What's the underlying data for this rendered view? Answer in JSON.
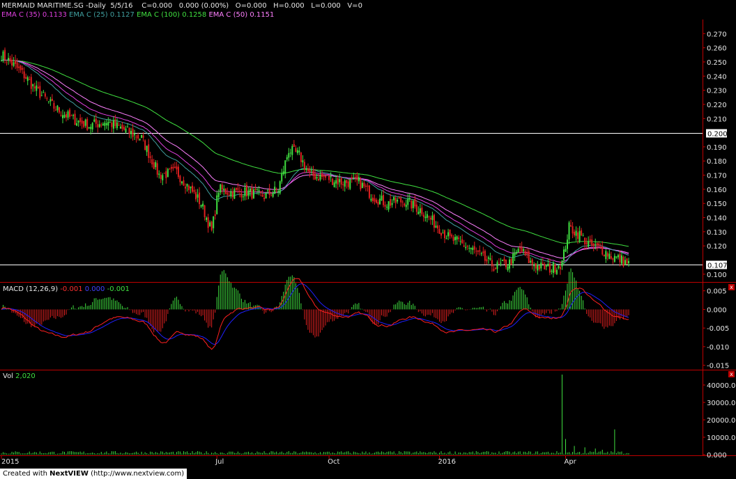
{
  "header": {
    "symbol": "MERMAID MARITIME.SG",
    "period": "-Daily",
    "date": "5/5/16",
    "close": "C=0.000",
    "change": "0.000 (0.00%)",
    "open": "O=0.000",
    "high": "H=0.000",
    "low": "L=0.000",
    "volume": "V=0"
  },
  "ema_legend": [
    {
      "label": "EMA C (35)",
      "value": "0.1133",
      "color": "#e040e0"
    },
    {
      "label": "EMA C (25)",
      "value": "0.1127",
      "color": "#40a0a0"
    },
    {
      "label": "EMA C (100)",
      "value": "0.1258",
      "color": "#40e040"
    },
    {
      "label": "EMA C (50)",
      "value": "0.1151",
      "color": "#ff80ff"
    }
  ],
  "macd_legend": {
    "label": "MACD (12,26,9)",
    "macd": "-0.001",
    "signal": "0.000",
    "hist": "-0.001"
  },
  "vol_legend": {
    "label": "Vol",
    "value": "2,020"
  },
  "footer": {
    "prefix": "Created with ",
    "brand_a": "Next",
    "brand_b": "VIEW",
    "url": "(http://www.nextview.com)"
  },
  "close_buttons": [
    "x",
    "x"
  ],
  "chart_data": [
    {
      "type": "candlestick",
      "title": "MERMAID MARITIME.SG -Daily",
      "ylim": [
        0.095,
        0.28
      ],
      "yticks": [
        "0.270",
        "0.260",
        "0.250",
        "0.240",
        "0.230",
        "0.220",
        "0.210",
        "0.200",
        "0.190",
        "0.180",
        "0.170",
        "0.160",
        "0.150",
        "0.140",
        "0.130",
        "0.120",
        "0.110",
        "0.100"
      ],
      "horizontal_lines": [
        {
          "value": 0.2,
          "label": "0.200"
        },
        {
          "value": 0.107,
          "label": "0.107"
        }
      ],
      "x_labels": [
        "2015",
        "Jul",
        "Oct",
        "2016",
        "Apr"
      ],
      "close_anchors": [
        [
          0,
          0.255
        ],
        [
          5,
          0.25
        ],
        [
          12,
          0.242
        ],
        [
          20,
          0.23
        ],
        [
          30,
          0.218
        ],
        [
          40,
          0.21
        ],
        [
          50,
          0.205
        ],
        [
          60,
          0.208
        ],
        [
          70,
          0.202
        ],
        [
          80,
          0.196
        ],
        [
          90,
          0.17
        ],
        [
          100,
          0.172
        ],
        [
          108,
          0.16
        ],
        [
          114,
          0.15
        ],
        [
          120,
          0.13
        ],
        [
          124,
          0.16
        ],
        [
          130,
          0.158
        ],
        [
          140,
          0.158
        ],
        [
          150,
          0.155
        ],
        [
          158,
          0.16
        ],
        [
          164,
          0.188
        ],
        [
          170,
          0.184
        ],
        [
          176,
          0.17
        ],
        [
          186,
          0.168
        ],
        [
          194,
          0.165
        ],
        [
          204,
          0.165
        ],
        [
          212,
          0.155
        ],
        [
          220,
          0.15
        ],
        [
          230,
          0.152
        ],
        [
          240,
          0.145
        ],
        [
          248,
          0.135
        ],
        [
          256,
          0.125
        ],
        [
          262,
          0.122
        ],
        [
          268,
          0.118
        ],
        [
          276,
          0.11
        ],
        [
          282,
          0.105
        ],
        [
          290,
          0.108
        ],
        [
          296,
          0.118
        ],
        [
          302,
          0.108
        ],
        [
          308,
          0.105
        ],
        [
          314,
          0.104
        ],
        [
          320,
          0.108
        ],
        [
          324,
          0.133
        ],
        [
          330,
          0.128
        ],
        [
          336,
          0.12
        ],
        [
          342,
          0.118
        ],
        [
          348,
          0.113
        ],
        [
          354,
          0.11
        ],
        [
          358,
          0.107
        ]
      ],
      "ema": [
        {
          "name": "EMA C (100)",
          "period": 100,
          "color": "#40e040"
        },
        {
          "name": "EMA C (50)",
          "period": 50,
          "color": "#ff80ff"
        },
        {
          "name": "EMA C (35)",
          "period": 35,
          "color": "#e040e0"
        },
        {
          "name": "EMA C (25)",
          "period": 25,
          "color": "#40a0a0"
        }
      ]
    },
    {
      "type": "macd",
      "name": "MACD (12,26,9)",
      "ylim": [
        -0.016,
        0.007
      ],
      "yticks": [
        "0.005",
        "0.000",
        "-0.005",
        "-0.010",
        "-0.015"
      ],
      "colors": {
        "macd": "#ff2020",
        "signal": "#2020ff",
        "hist_pos": "#40e040",
        "hist_neg": "#e02020"
      }
    },
    {
      "type": "bar",
      "name": "Vol",
      "ylim": [
        0,
        48000
      ],
      "yticks": [
        "40000.00",
        "30000.00",
        "20000.00",
        "10000.00",
        "0.000"
      ],
      "spikes": [
        [
          320,
          46000
        ],
        [
          322,
          9000
        ],
        [
          327,
          5000
        ],
        [
          333,
          4200
        ],
        [
          339,
          3500
        ],
        [
          350,
          14500
        ],
        [
          343,
          2800
        ]
      ],
      "base_volume": 1200,
      "color": "#40e040"
    }
  ]
}
